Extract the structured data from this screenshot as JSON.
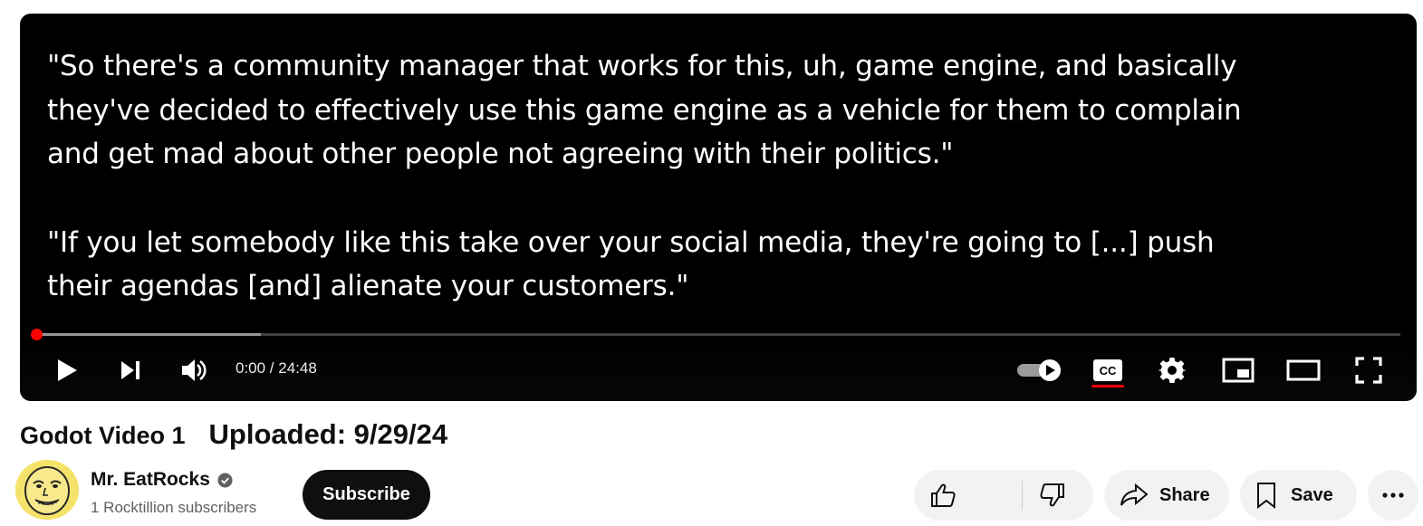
{
  "player": {
    "caption_paragraphs": [
      "\"So there's a community manager that works for this, uh, game engine, and basically\nthey've decided to effectively use this game engine as a vehicle for them to complain\nand get mad about other people not agreeing with their politics.\"",
      "\"If you let somebody like this take over your social media, they're going to [...] push\ntheir agendas [and] alienate your customers.\""
    ],
    "time_display": "0:00 / 24:48",
    "progress_fraction": 0.0,
    "buffered_fraction": 0.165,
    "autoplay_on": true,
    "captions_on": true,
    "icons": [
      "play-icon",
      "next-icon",
      "volume-icon",
      "autoplay-toggle-icon",
      "captions-icon",
      "settings-icon",
      "miniplayer-icon",
      "theater-mode-icon",
      "fullscreen-icon"
    ],
    "accent_color": "#ff0000"
  },
  "video": {
    "title": "Godot Video 1",
    "upload_info": "Uploaded: 9/29/24"
  },
  "channel": {
    "name": "Mr. EatRocks",
    "verified": true,
    "subscribers": "1 Rocktillion subscribers",
    "subscribe_label": "Subscribe"
  },
  "actions": {
    "like_icon": "thumbs-up-icon",
    "dislike_icon": "thumbs-down-icon",
    "share_label": "Share",
    "share_icon": "share-arrow-icon",
    "save_label": "Save",
    "save_icon": "bookmark-icon",
    "more_icon": "more-horizontal-icon"
  }
}
